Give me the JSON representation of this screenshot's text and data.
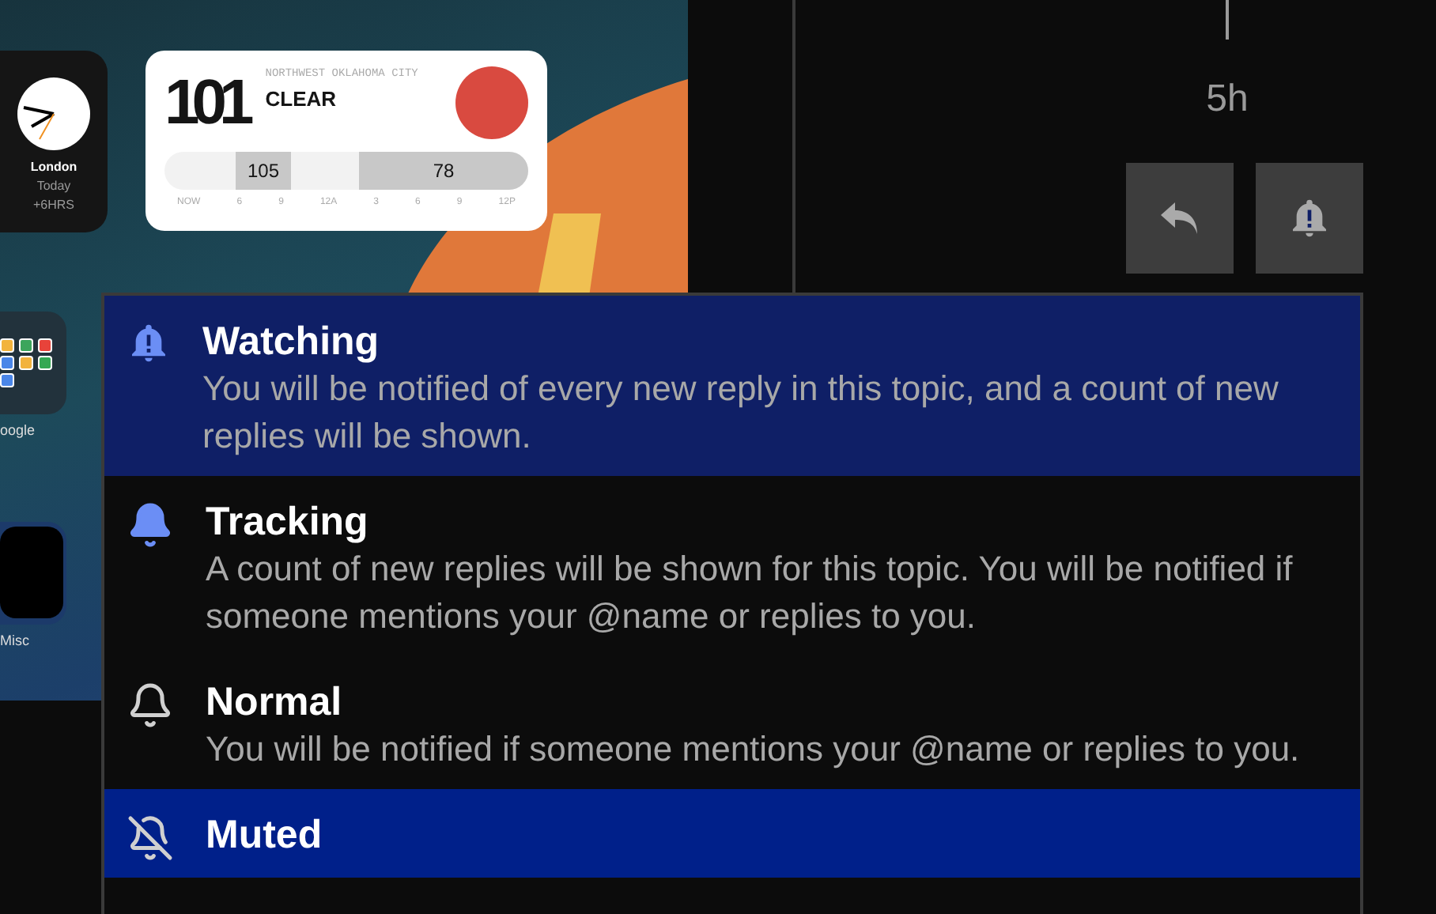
{
  "home_screen": {
    "clock_widget": {
      "city": "London",
      "day": "Today",
      "offset": "+6HRS"
    },
    "weather_widget": {
      "temperature": "101",
      "location": "NORTHWEST OKLAHOMA CITY",
      "condition": "CLEAR",
      "high": "105",
      "low": "78",
      "hours": [
        "NOW",
        "6",
        "9",
        "12A",
        "3",
        "6",
        "9",
        "12P"
      ]
    },
    "folders": [
      {
        "label": "oogle",
        "kind": "apps"
      },
      {
        "label": "Misc",
        "kind": "hidden"
      }
    ]
  },
  "topic": {
    "age": "5h"
  },
  "notification_menu": [
    {
      "kind": "watching",
      "title": "Watching",
      "description": "You will be notified of every new reply in this topic, and a count of new replies will be shown.",
      "selected": true,
      "focused": false
    },
    {
      "kind": "tracking",
      "title": "Tracking",
      "description": "A count of new replies will be shown for this topic. You will be notified if someone mentions your @name or replies to you.",
      "selected": false,
      "focused": false
    },
    {
      "kind": "normal",
      "title": "Normal",
      "description": "You will be notified if someone mentions your @name or replies to you.",
      "selected": false,
      "focused": false
    },
    {
      "kind": "muted",
      "title": "Muted",
      "selected": false,
      "focused": true
    }
  ]
}
